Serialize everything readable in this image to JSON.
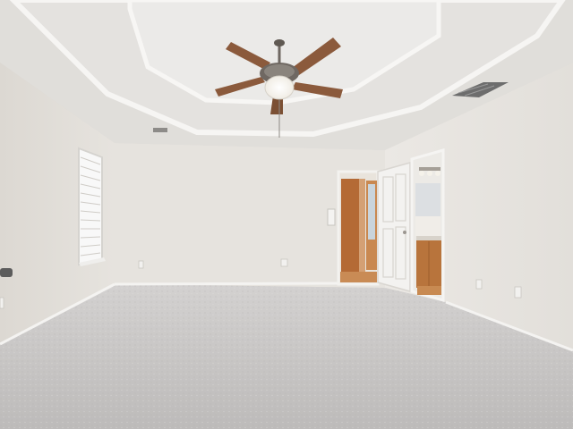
{
  "scene": {
    "description_visible_text": [],
    "palette": {
      "ceiling": "#e3e1de",
      "tray_ceiling": "#ecebea",
      "trim": "#f2f1ef",
      "wall_left": "#e4e1dc",
      "wall_back": "#e7e4df",
      "wall_right": "#e9e6e2",
      "carpet": "#c9c7c6",
      "wood": "#b86f3a",
      "fan_blade": "#8b5a3c",
      "fan_metal": "#6f6862"
    }
  }
}
